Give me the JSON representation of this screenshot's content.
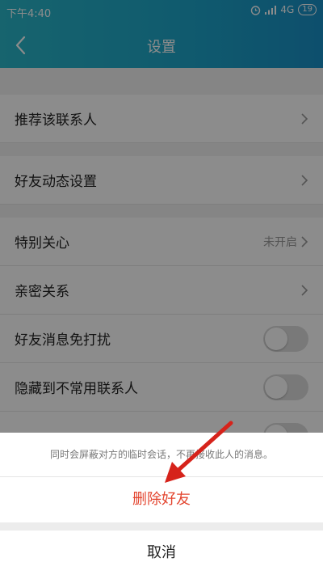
{
  "status_bar": {
    "time": "下午4:40",
    "network": "4G",
    "battery": "19"
  },
  "header": {
    "title": "设置"
  },
  "rows": [
    {
      "label": "推荐该联系人"
    },
    {
      "label": "好友动态设置"
    },
    {
      "label": "特别关心",
      "value": "未开启"
    },
    {
      "label": "亲密关系"
    },
    {
      "label": "好友消息免打扰",
      "toggle_on": false
    },
    {
      "label": "隐藏到不常用联系人",
      "toggle_on": false
    }
  ],
  "sheet": {
    "message": "同时会屏蔽对方的临时会话，不再接收此人的消息。",
    "delete_label": "删除好友",
    "cancel_label": "取消"
  },
  "colors": {
    "header": "#1ea6c8",
    "danger": "#e3452f",
    "arrow": "#d6231b"
  }
}
